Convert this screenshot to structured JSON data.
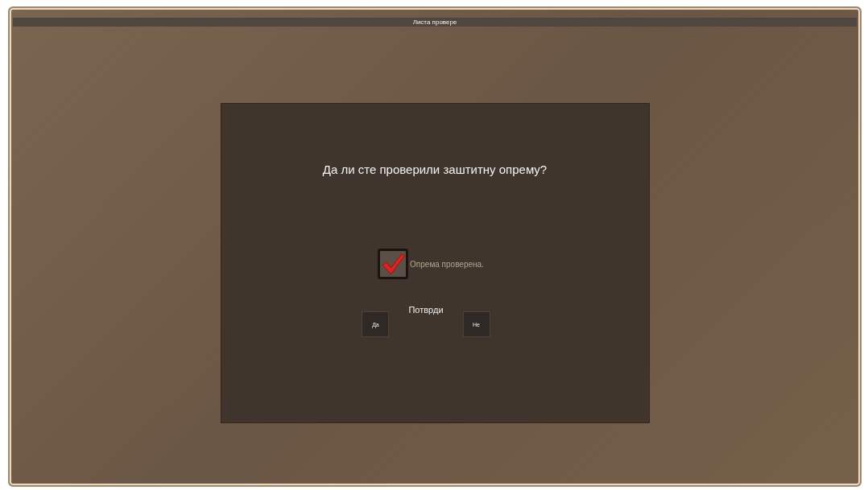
{
  "window": {
    "title": "Листа провере"
  },
  "dialog": {
    "question": "Да ли сте проверили заштитну опрему?",
    "checkbox": {
      "label": "Опрема проверена.",
      "checked": true
    },
    "confirm_label": "Потврди",
    "buttons": [
      {
        "label": "Да"
      },
      {
        "label": "Не"
      }
    ]
  }
}
